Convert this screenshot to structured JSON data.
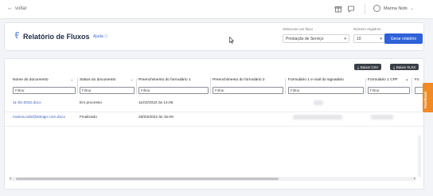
{
  "topbar": {
    "back_label": "voltar",
    "user_name": "Marina Nobi",
    "icons": [
      "arrow-left-icon",
      "gift-icon",
      "chat-icon",
      "user-avatar-icon",
      "chevron-down-icon"
    ]
  },
  "report": {
    "title": "Relatório de Fluxos",
    "help_label": "Ajuda",
    "flow_select_label": "Selecione um fluxo",
    "flow_select_value": "Prestação de Serviço",
    "records_label": "Número registros",
    "records_value": "10",
    "generate_button": "Gerar relatório"
  },
  "table": {
    "download_csv": "Baixar CSV",
    "download_xlsx": "Baixar XLSX",
    "filter_placeholder": "Filtrar",
    "columns": [
      "Nome do documento",
      "Status do documento",
      "Preenchimento do formulário 1",
      "Preenchimento do formulário 2",
      "Formulário 1 e mail do signatário",
      "Formulário 1 CPF",
      "Fo"
    ],
    "rows": [
      {
        "name": "11-02-2022.docx",
        "status": "Em processo",
        "form1": "11/02/2022 às 14:06"
      },
      {
        "name": "marina.nobi@d4sign.com.docx",
        "status": "Finalizado",
        "form1": "28/03/2022 às 15:09"
      }
    ]
  },
  "side_tab": {
    "label": "Feedback"
  },
  "colors": {
    "primary": "#2f62d9",
    "accent_orange": "#f08a24",
    "dark_button": "#3a3f47"
  }
}
